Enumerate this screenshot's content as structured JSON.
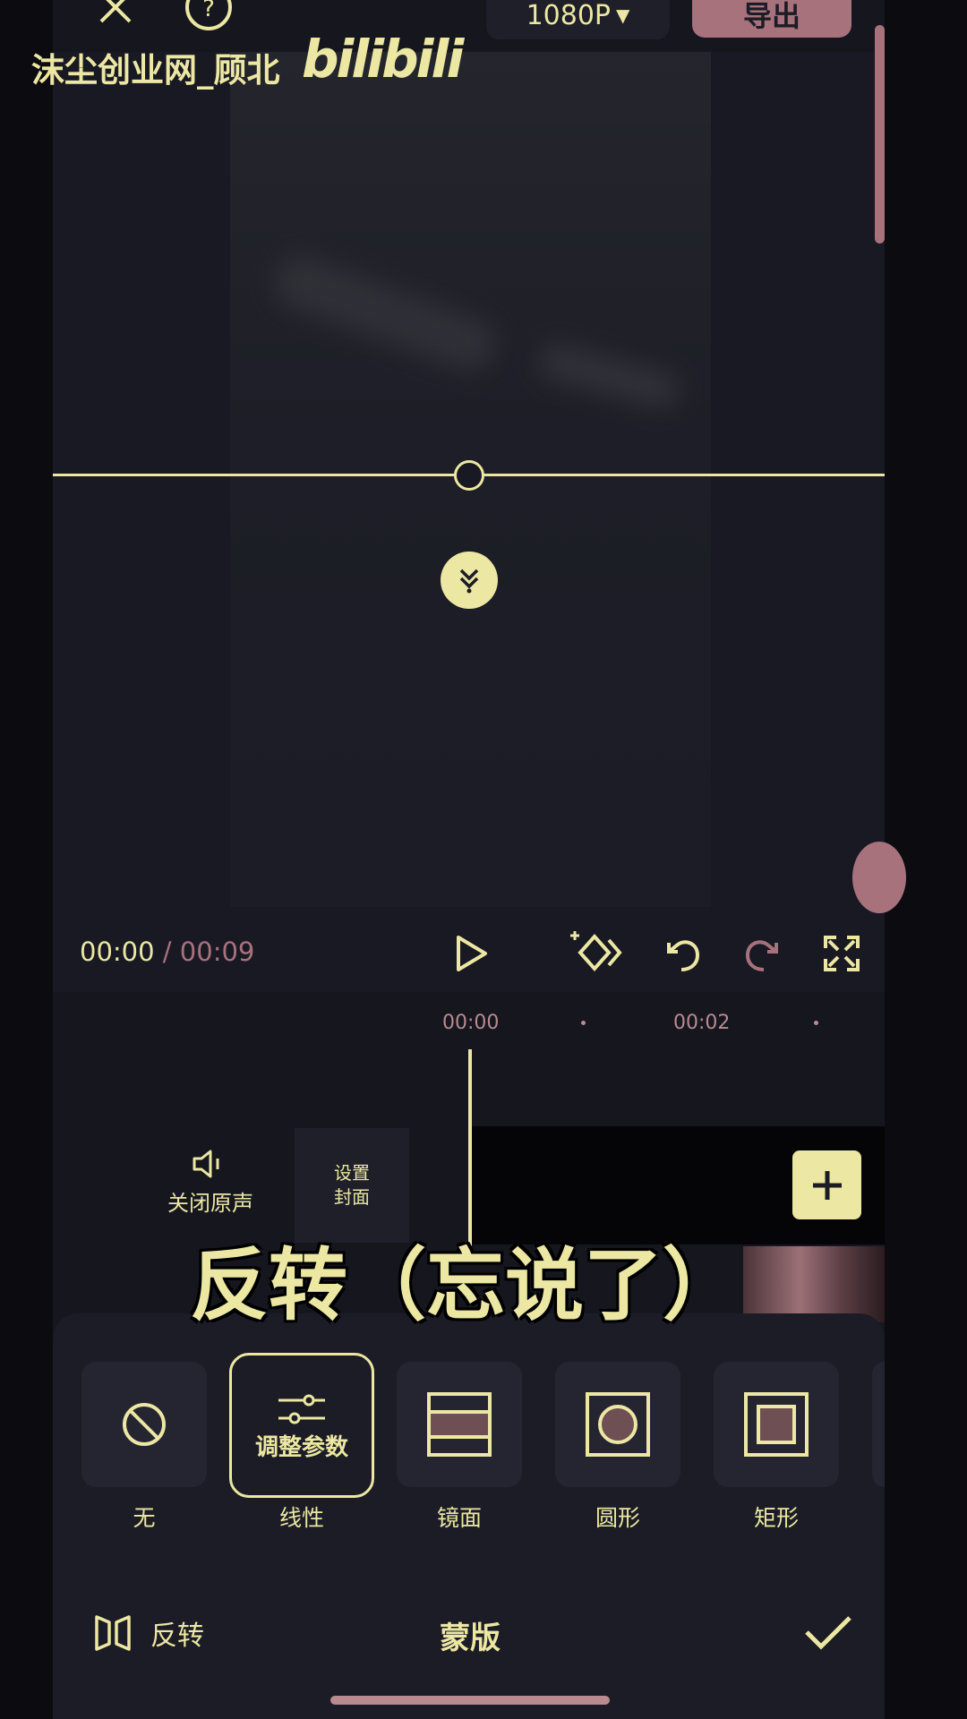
{
  "topbar": {
    "resolution": "1080P",
    "export_label": "导出"
  },
  "watermark": {
    "text": "沫尘创业网_顾北",
    "logo": "bilibili"
  },
  "player": {
    "current_time": "00:00",
    "separator": " / ",
    "total_time": "00:09"
  },
  "timeline": {
    "ticks": [
      "00:00",
      "00:02"
    ],
    "mute_label": "关闭原声",
    "cover_label_line1": "设置",
    "cover_label_line2": "封面"
  },
  "caption": "反转（忘说了）",
  "mask_options": [
    {
      "label": "无",
      "icon": "none-icon"
    },
    {
      "label": "线性",
      "icon": "adjust-params-icon",
      "overlay": "调整参数",
      "active": true
    },
    {
      "label": "镜面",
      "icon": "mirror-icon"
    },
    {
      "label": "圆形",
      "icon": "circle-icon"
    },
    {
      "label": "矩形",
      "icon": "rectangle-icon"
    }
  ],
  "footer": {
    "invert_label": "反转",
    "title": "蒙版"
  },
  "colors": {
    "accent": "#ece7a3",
    "muted": "#a8727d",
    "background": "#15161e"
  }
}
